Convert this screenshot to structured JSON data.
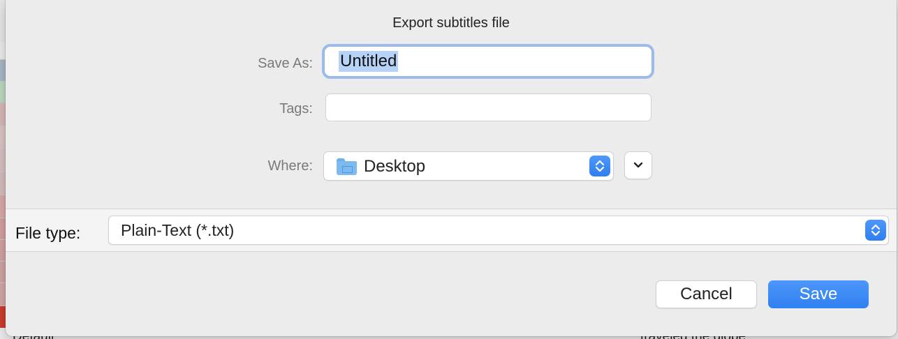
{
  "dialog": {
    "title": "Export subtitles file",
    "save_as_label": "Save As:",
    "save_as_value": "Untitled",
    "tags_label": "Tags:",
    "tags_value": "",
    "where_label": "Where:",
    "where_value": "Desktop",
    "file_type_label": "File type:",
    "file_type_value": "Plain-Text (*.txt)",
    "cancel_label": "Cancel",
    "save_label": "Save"
  },
  "background": {
    "left_text": "Default",
    "right_text": "traveled the globe"
  },
  "colors": {
    "accent": "#2f80f1",
    "selection": "#b6d2f6",
    "focus_ring": "#9bbcee",
    "folder": "#7cbaf0"
  },
  "icons": {
    "folder": "folder-icon",
    "stepper": "up-down-chevrons-icon",
    "expand": "chevron-down-icon"
  }
}
